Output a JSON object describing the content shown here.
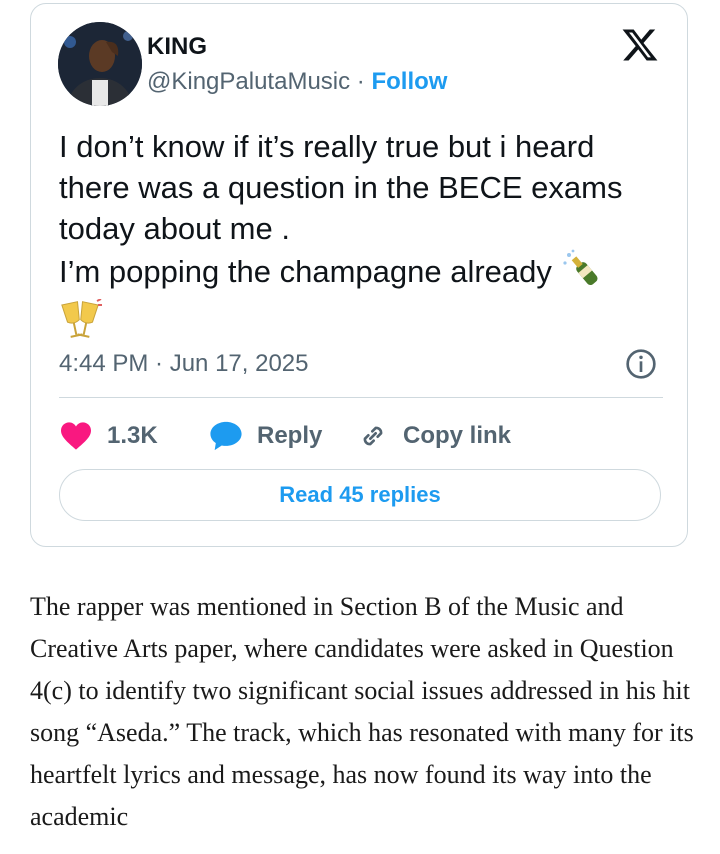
{
  "tweet": {
    "author_name": "KING",
    "handle": "@KingPalutaMusic",
    "separator": "·",
    "follow_label": "Follow",
    "text_line_1": "I don’t know if it’s really true but i heard there was a question in the BECE exams today about me .",
    "text_line_2": "I’m popping the champagne already",
    "emojis": [
      "champagne-bottle-icon",
      "clinking-glasses-icon"
    ],
    "timestamp": "4:44 PM · Jun 17, 2025",
    "likes": "1.3K",
    "reply_label": "Reply",
    "copy_link_label": "Copy link",
    "read_replies_label": "Read 45 replies",
    "colors": {
      "accent": "#1d9bf0",
      "heart": "#f91880",
      "muted": "#536471",
      "border": "#cfd9de"
    }
  },
  "article": {
    "paragraph": "The rapper was mentioned in Section B of the Music and Creative Arts paper, where candidates were asked in Question 4(c) to identify two significant social issues addressed in his hit song “Aseda.” The track, which has resonated with many for its heartfelt lyrics and message, has now found its way into the academic"
  }
}
